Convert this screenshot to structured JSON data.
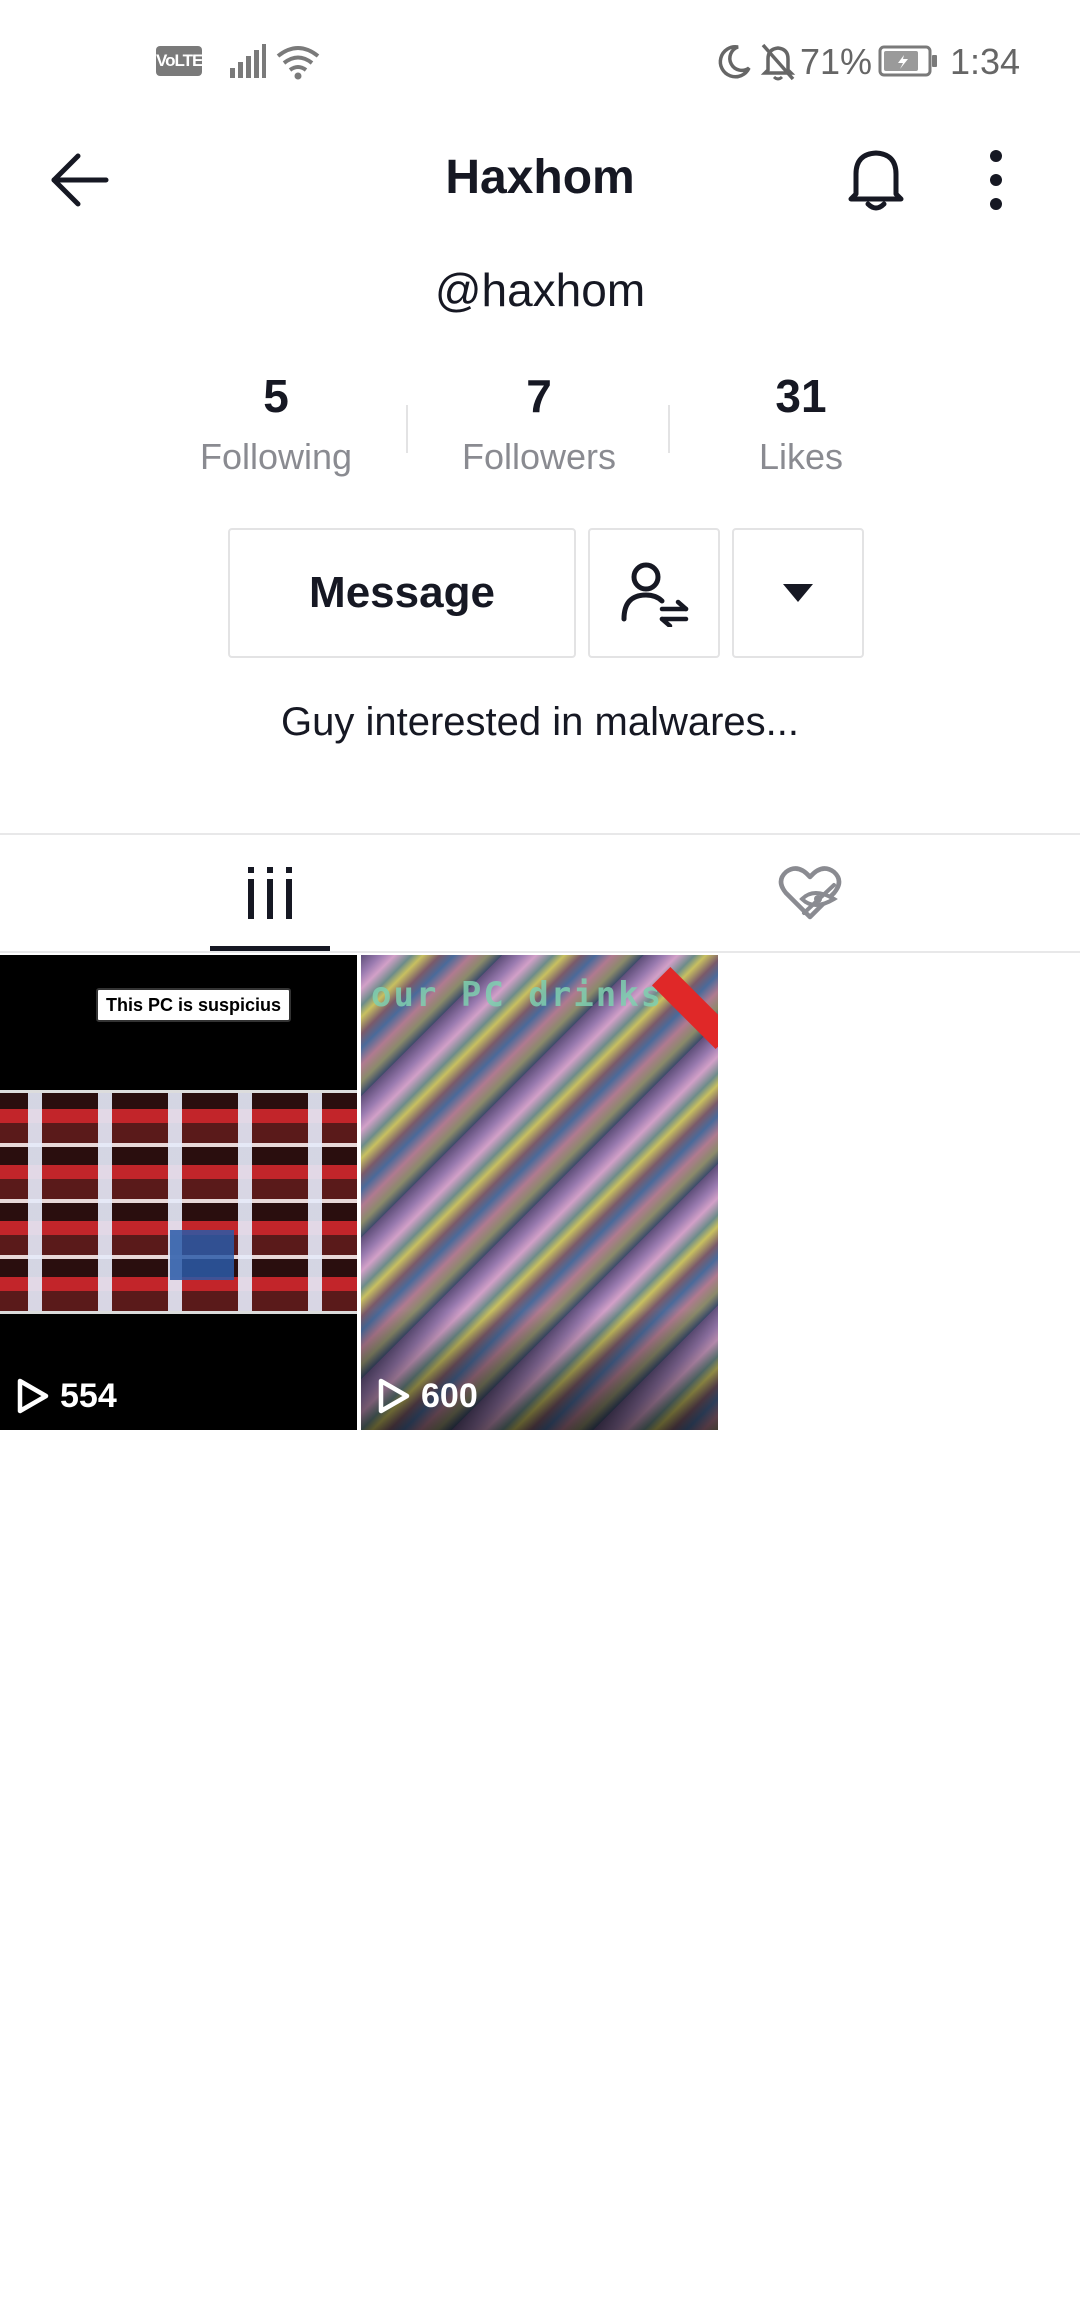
{
  "status_bar": {
    "volte": "VoLTE",
    "battery": "71%",
    "time": "1:34",
    "icons": [
      "signal-icon",
      "wifi-icon",
      "moon-icon",
      "bell-off-icon",
      "battery-icon"
    ]
  },
  "header": {
    "title": "Haxhom",
    "icons": [
      "back-arrow-icon",
      "bell-icon",
      "more-vertical-icon"
    ]
  },
  "profile": {
    "handle": "@haxhom",
    "bio": "Guy interested in malwares..."
  },
  "stats": [
    {
      "value": "5",
      "label": "Following"
    },
    {
      "value": "7",
      "label": "Followers"
    },
    {
      "value": "31",
      "label": "Likes"
    }
  ],
  "actions": {
    "message_label": "Message",
    "icons": [
      "person-swap-icon",
      "caret-down-icon"
    ]
  },
  "tabs": [
    {
      "icon": "grid-icon",
      "active": true
    },
    {
      "icon": "liked-hidden-icon",
      "active": false
    }
  ],
  "videos": [
    {
      "views": "554",
      "caption": "This PC is suspicius"
    },
    {
      "views": "600",
      "overlay_text": "our PC drinks"
    }
  ],
  "colors": {
    "text_primary": "#161823",
    "text_secondary": "#8a8b91",
    "divider": "#e3e3e4",
    "background": "#ffffff"
  }
}
